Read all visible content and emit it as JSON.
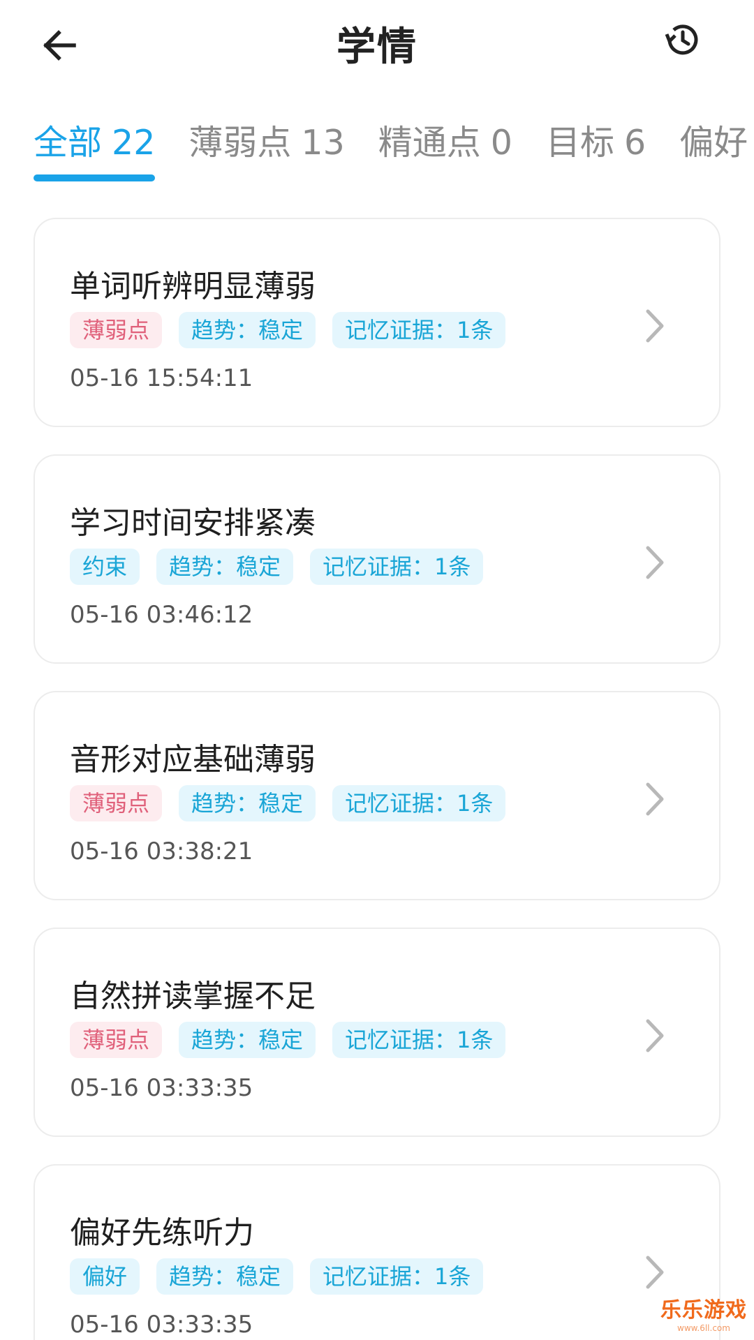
{
  "header": {
    "title": "学情"
  },
  "tabs": [
    {
      "label": "全部",
      "count": "22",
      "active": true
    },
    {
      "label": "薄弱点",
      "count": "13",
      "active": false
    },
    {
      "label": "精通点",
      "count": "0",
      "active": false
    },
    {
      "label": "目标",
      "count": "6",
      "active": false
    },
    {
      "label": "偏好",
      "count": "",
      "active": false
    }
  ],
  "cards": [
    {
      "title": "单词听辨明显薄弱",
      "tags": [
        {
          "text": "薄弱点",
          "kind": "weak"
        },
        {
          "text": "趋势：稳定",
          "kind": "info"
        },
        {
          "text": "记忆证据：1条",
          "kind": "info"
        }
      ],
      "time": "05-16 15:54:11"
    },
    {
      "title": "学习时间安排紧凑",
      "tags": [
        {
          "text": "约束",
          "kind": "info"
        },
        {
          "text": "趋势：稳定",
          "kind": "info"
        },
        {
          "text": "记忆证据：1条",
          "kind": "info"
        }
      ],
      "time": "05-16 03:46:12"
    },
    {
      "title": "音形对应基础薄弱",
      "tags": [
        {
          "text": "薄弱点",
          "kind": "weak"
        },
        {
          "text": "趋势：稳定",
          "kind": "info"
        },
        {
          "text": "记忆证据：1条",
          "kind": "info"
        }
      ],
      "time": "05-16 03:38:21"
    },
    {
      "title": "自然拼读掌握不足",
      "tags": [
        {
          "text": "薄弱点",
          "kind": "weak"
        },
        {
          "text": "趋势：稳定",
          "kind": "info"
        },
        {
          "text": "记忆证据：1条",
          "kind": "info"
        }
      ],
      "time": "05-16 03:33:35"
    },
    {
      "title": "偏好先练听力",
      "tags": [
        {
          "text": "偏好",
          "kind": "info"
        },
        {
          "text": "趋势：稳定",
          "kind": "info"
        },
        {
          "text": "记忆证据：1条",
          "kind": "info"
        }
      ],
      "time": "05-16 03:33:35"
    }
  ],
  "watermark": {
    "text": "乐乐游戏",
    "url": "www.6ll.com"
  },
  "colors": {
    "accent": "#1aa3e8",
    "weak_bg": "#fdecef",
    "weak_fg": "#e0607a",
    "info_bg": "#e4f6fd",
    "info_fg": "#19a5d6"
  }
}
